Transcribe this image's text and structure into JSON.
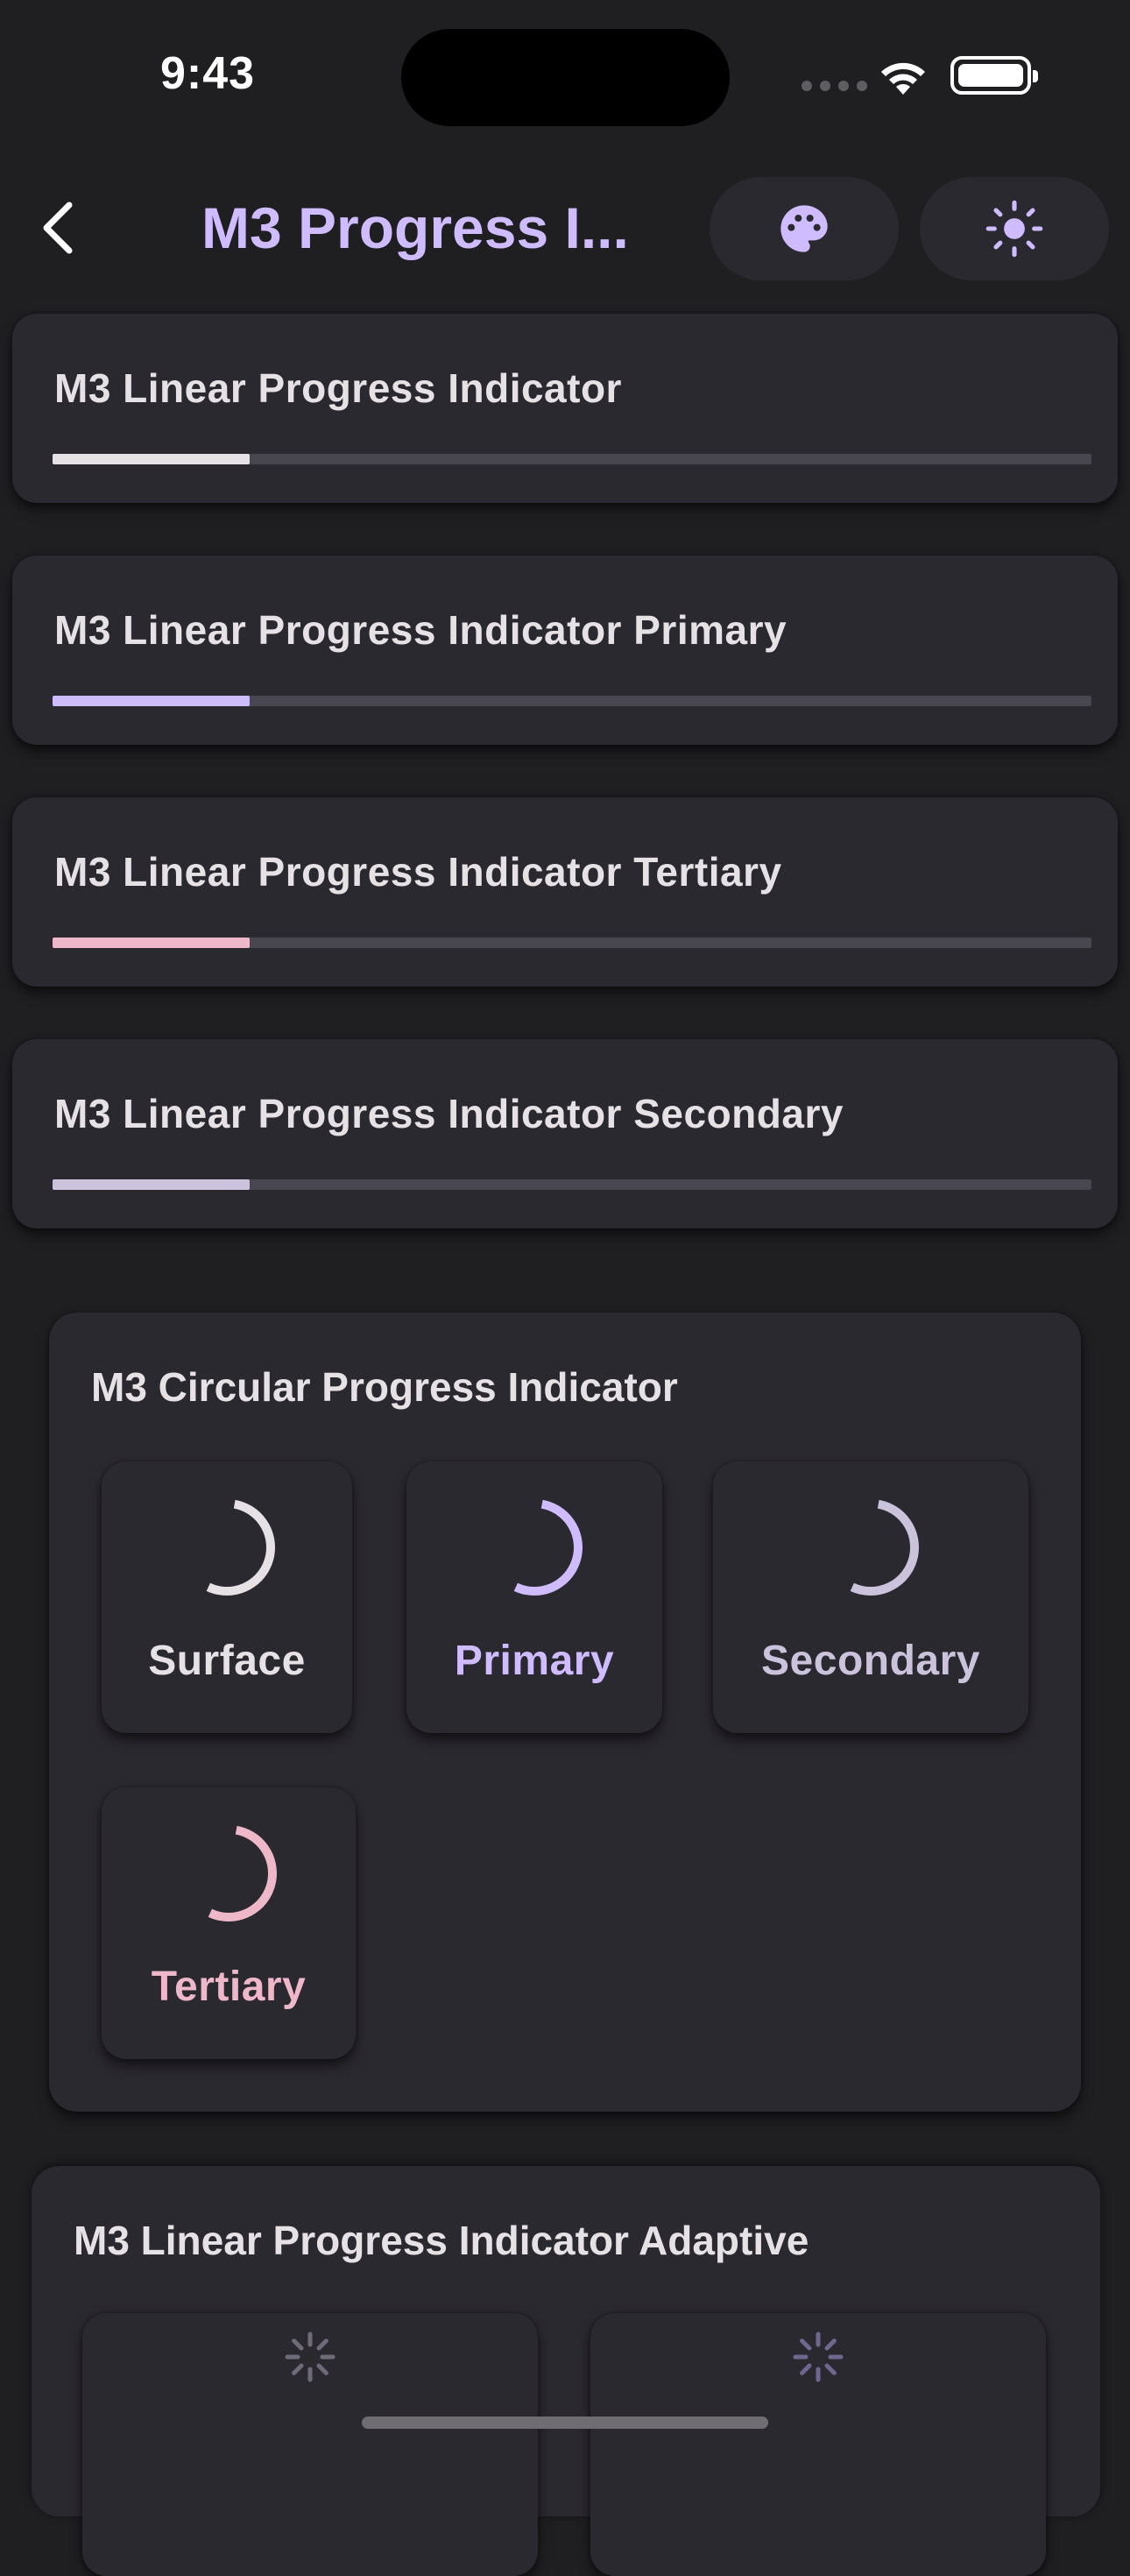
{
  "status_bar": {
    "time": "9:43"
  },
  "app_bar": {
    "title": "M3 Progress I...",
    "back_icon": "chevron-left-icon",
    "palette_icon": "palette-icon",
    "theme_icon": "sun-icon"
  },
  "linear_indicators": [
    {
      "label": "M3 Linear Progress Indicator",
      "color": "#e6e1e5",
      "progress": 0.19
    },
    {
      "label": "M3 Linear Progress Indicator Primary",
      "color": "#cfbcff",
      "progress": 0.19
    },
    {
      "label": "M3 Linear Progress Indicator Tertiary",
      "color": "#efb8c8",
      "progress": 0.19
    },
    {
      "label": "M3 Linear Progress Indicator Secondary",
      "color": "#cbc2db",
      "progress": 0.19
    }
  ],
  "circular_section": {
    "title": "M3 Circular Progress Indicator",
    "items": [
      {
        "label": "Surface",
        "color": "#e6e1e5"
      },
      {
        "label": "Primary",
        "color": "#cfbcff"
      },
      {
        "label": "Secondary",
        "color": "#cbc2db"
      },
      {
        "label": "Tertiary",
        "color": "#efb8c8"
      }
    ]
  },
  "adaptive_section": {
    "title": "M3 Linear Progress Indicator Adaptive"
  },
  "colors": {
    "background": "#1f1f22",
    "surface": "#2b2930",
    "track": "#48464e",
    "primary": "#cfbcff"
  }
}
